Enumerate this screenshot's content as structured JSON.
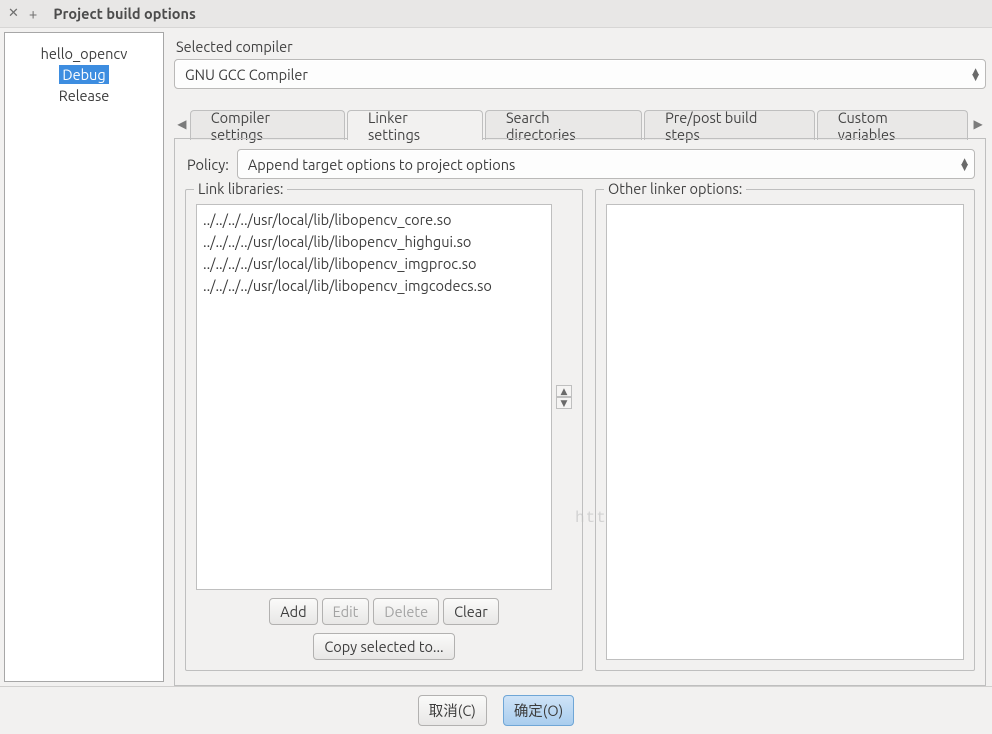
{
  "window": {
    "title": "Project build options"
  },
  "tree": {
    "items": [
      {
        "label": "hello_opencv",
        "selected": false
      },
      {
        "label": "Debug",
        "selected": true
      },
      {
        "label": "Release",
        "selected": false
      }
    ]
  },
  "compiler": {
    "label": "Selected compiler",
    "value": "GNU GCC Compiler"
  },
  "tabs": {
    "items": [
      {
        "label": "Compiler settings"
      },
      {
        "label": "Linker settings"
      },
      {
        "label": "Search directories"
      },
      {
        "label": "Pre/post build steps"
      },
      {
        "label": "Custom variables"
      }
    ],
    "active_index": 1
  },
  "policy": {
    "label": "Policy:",
    "value": "Append target options to project options"
  },
  "link_libraries": {
    "legend": "Link libraries:",
    "items": [
      "../../../../usr/local/lib/libopencv_core.so",
      "../../../../usr/local/lib/libopencv_highgui.so",
      "../../../../usr/local/lib/libopencv_imgproc.so",
      "../../../../usr/local/lib/libopencv_imgcodecs.so"
    ],
    "buttons": {
      "add": "Add",
      "edit": "Edit",
      "delete": "Delete",
      "clear": "Clear",
      "copy": "Copy selected to..."
    }
  },
  "other_linker": {
    "legend": "Other linker options:",
    "value": ""
  },
  "dialog_buttons": {
    "cancel": "取消(C)",
    "ok": "确定(O)"
  },
  "watermark": "http://blog.csdn.net/"
}
